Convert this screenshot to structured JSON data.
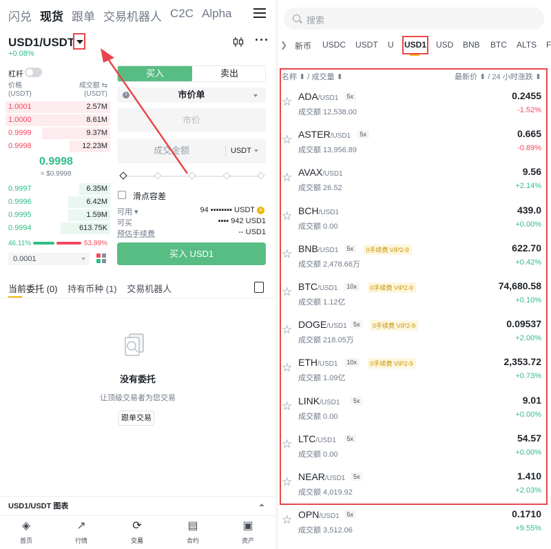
{
  "left": {
    "nav": [
      "闪兑",
      "现货",
      "跟单",
      "交易机器人",
      "C2C",
      "Alpha"
    ],
    "nav_active": "现货",
    "pair": "USD1/USDT",
    "pair_change": "+0.08%",
    "leverage_label": "杠杆",
    "orderbook": {
      "price_header": "价格",
      "price_unit": "(USDT)",
      "volume_header": "成交额 ⇆",
      "volume_unit": "(USDT)",
      "asks": [
        {
          "price": "1.0001",
          "qty": "2.57M",
          "depth": 0.95
        },
        {
          "price": "1.0000",
          "qty": "8.61M",
          "depth": 0.95
        },
        {
          "price": "0.9999",
          "qty": "9.37M",
          "depth": 0.62
        },
        {
          "price": "0.9998",
          "qty": "12.23M",
          "depth": 0.37
        }
      ],
      "mid_price": "0.9998",
      "mid_usd": "≈ $0.9998",
      "bids": [
        {
          "price": "0.9997",
          "qty": "6.35M",
          "depth": 0.28
        },
        {
          "price": "0.9996",
          "qty": "6.42M",
          "depth": 0.38
        },
        {
          "price": "0.9995",
          "qty": "1.59M",
          "depth": 0.38
        },
        {
          "price": "0.9994",
          "qty": "613.75K",
          "depth": 0.45
        }
      ],
      "buy_ratio": "46.11%",
      "sell_ratio": "53.89%",
      "precision": "0.0001"
    },
    "form": {
      "buy_tab": "买入",
      "sell_tab": "卖出",
      "order_type": "市价单",
      "market_price": "市价",
      "amount_label": "成交金额",
      "amount_currency": "USDT",
      "slippage": "滑点容差",
      "available_label": "可用 ▾",
      "available_value": "94 ▪▪▪▪▪▪▪▪ USDT",
      "buyable_label": "可买",
      "buyable_value": "▪▪▪▪ 942 USD1",
      "fee_label": "预估手续费",
      "fee_value": "-- USD1",
      "buy_button": "买入 USD1"
    },
    "orders": {
      "tabs": [
        "当前委托 (0)",
        "持有币种 (1)",
        "交易机器人"
      ],
      "empty_title": "没有委托",
      "empty_sub": "让顶级交易者为您交易",
      "copy_button": "跟单交易"
    },
    "chart_label": "USD1/USDT 图表",
    "bottom_nav": [
      {
        "label": "首页",
        "icon": "home-icon"
      },
      {
        "label": "行情",
        "icon": "markets-icon"
      },
      {
        "label": "交易",
        "icon": "trade-icon"
      },
      {
        "label": "合约",
        "icon": "futures-icon"
      },
      {
        "label": "资产",
        "icon": "wallet-icon"
      }
    ]
  },
  "right": {
    "search_placeholder": "搜索",
    "quote_tabs": [
      "新币",
      "USDC",
      "USDT",
      "U",
      "USD1",
      "USD",
      "BNB",
      "BTC",
      "ALTS",
      "F"
    ],
    "active_tab": "USD1",
    "header_left": "名称 ⬍ / 成交量 ⬍",
    "header_right": "最新价 ⬍ / 24 小时涨跌 ⬍",
    "rows": [
      {
        "sym": "ADA",
        "quote": "/USD1",
        "lev": "5x",
        "promo": "",
        "vol": "成交额 12,538.00",
        "price": "0.2455",
        "chg": "-1.52%",
        "dir": "down"
      },
      {
        "sym": "ASTER",
        "quote": "/USD1",
        "lev": "5x",
        "promo": "",
        "vol": "成交额 13,956.89",
        "price": "0.665",
        "chg": "-0.89%",
        "dir": "down"
      },
      {
        "sym": "AVAX",
        "quote": "/USD1",
        "lev": "",
        "promo": "",
        "vol": "成交额 26.52",
        "price": "9.56",
        "chg": "+2.14%",
        "dir": "up"
      },
      {
        "sym": "BCH",
        "quote": "/USD1",
        "lev": "",
        "promo": "",
        "vol": "成交额 0.00",
        "price": "439.0",
        "chg": "+0.00%",
        "dir": "up"
      },
      {
        "sym": "BNB",
        "quote": "/USD1",
        "lev": "5x",
        "promo": "0手续费 VIP2-9",
        "vol": "成交额 2,478.66万",
        "price": "622.70",
        "chg": "+0.42%",
        "dir": "up"
      },
      {
        "sym": "BTC",
        "quote": "/USD1",
        "lev": "10x",
        "promo": "0手续费 VIP2-9",
        "vol": "成交额 1.12亿",
        "price": "74,680.58",
        "chg": "+0.10%",
        "dir": "up"
      },
      {
        "sym": "DOGE",
        "quote": "/USD1",
        "lev": "5x",
        "promo": "0手续费 VIP2-9",
        "vol": "成交额 218.05万",
        "price": "0.09537",
        "chg": "+2.00%",
        "dir": "up"
      },
      {
        "sym": "ETH",
        "quote": "/USD1",
        "lev": "10x",
        "promo": "0手续费 VIP2-9",
        "vol": "成交额 1.09亿",
        "price": "2,353.72",
        "chg": "+0.73%",
        "dir": "up"
      },
      {
        "sym": "LINK",
        "quote": "/USD1",
        "lev": "5x",
        "promo": "",
        "vol": "成交额 0.00",
        "price": "9.01",
        "chg": "+0.00%",
        "dir": "up"
      },
      {
        "sym": "LTC",
        "quote": "/USD1",
        "lev": "5x",
        "promo": "",
        "vol": "成交额 0.00",
        "price": "54.57",
        "chg": "+0.00%",
        "dir": "up"
      },
      {
        "sym": "NEAR",
        "quote": "/USD1",
        "lev": "5x",
        "promo": "",
        "vol": "成交额 4,019.92",
        "price": "1.410",
        "chg": "+2.03%",
        "dir": "up"
      },
      {
        "sym": "OPN",
        "quote": "/USD1",
        "lev": "5x",
        "promo": "",
        "vol": "成交额 3,512.06",
        "price": "0.1710",
        "chg": "+9.55%",
        "dir": "up"
      }
    ]
  },
  "colors": {
    "up": "#2ebd85",
    "down": "#f6465d",
    "accent": "#f0b90b",
    "buy": "#58bd83",
    "annotation": "#e8464a"
  }
}
